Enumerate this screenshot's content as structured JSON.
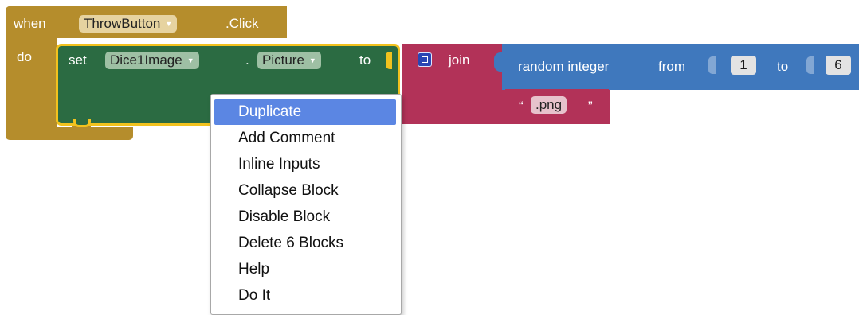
{
  "event_block": {
    "when_label": "when",
    "component": "ThrowButton",
    "event": ".Click",
    "do_label": "do"
  },
  "set_block": {
    "set_label": "set",
    "component": "Dice1Image",
    "dot": ".",
    "property": "Picture",
    "to_label": "to"
  },
  "join_block": {
    "label": "join"
  },
  "random_block": {
    "label": "random integer",
    "from_label": "from",
    "from_value": "1",
    "to_label": "to",
    "to_value": "6"
  },
  "text_block": {
    "open_quote": "“",
    "value": ".png",
    "close_quote": "”"
  },
  "context_menu": {
    "selected_index": 0,
    "items": [
      {
        "label": "Duplicate"
      },
      {
        "label": "Add Comment"
      },
      {
        "label": "Inline Inputs"
      },
      {
        "label": "Collapse Block"
      },
      {
        "label": "Disable Block"
      },
      {
        "label": "Delete 6 Blocks"
      },
      {
        "label": "Help"
      },
      {
        "label": "Do It"
      }
    ]
  },
  "colors": {
    "event": "#b58d2c",
    "set": "#2b6b42",
    "selection": "#f2c21e",
    "join": "#b23258",
    "math": "#3f78bd",
    "menu_highlight": "#5b86e3"
  }
}
